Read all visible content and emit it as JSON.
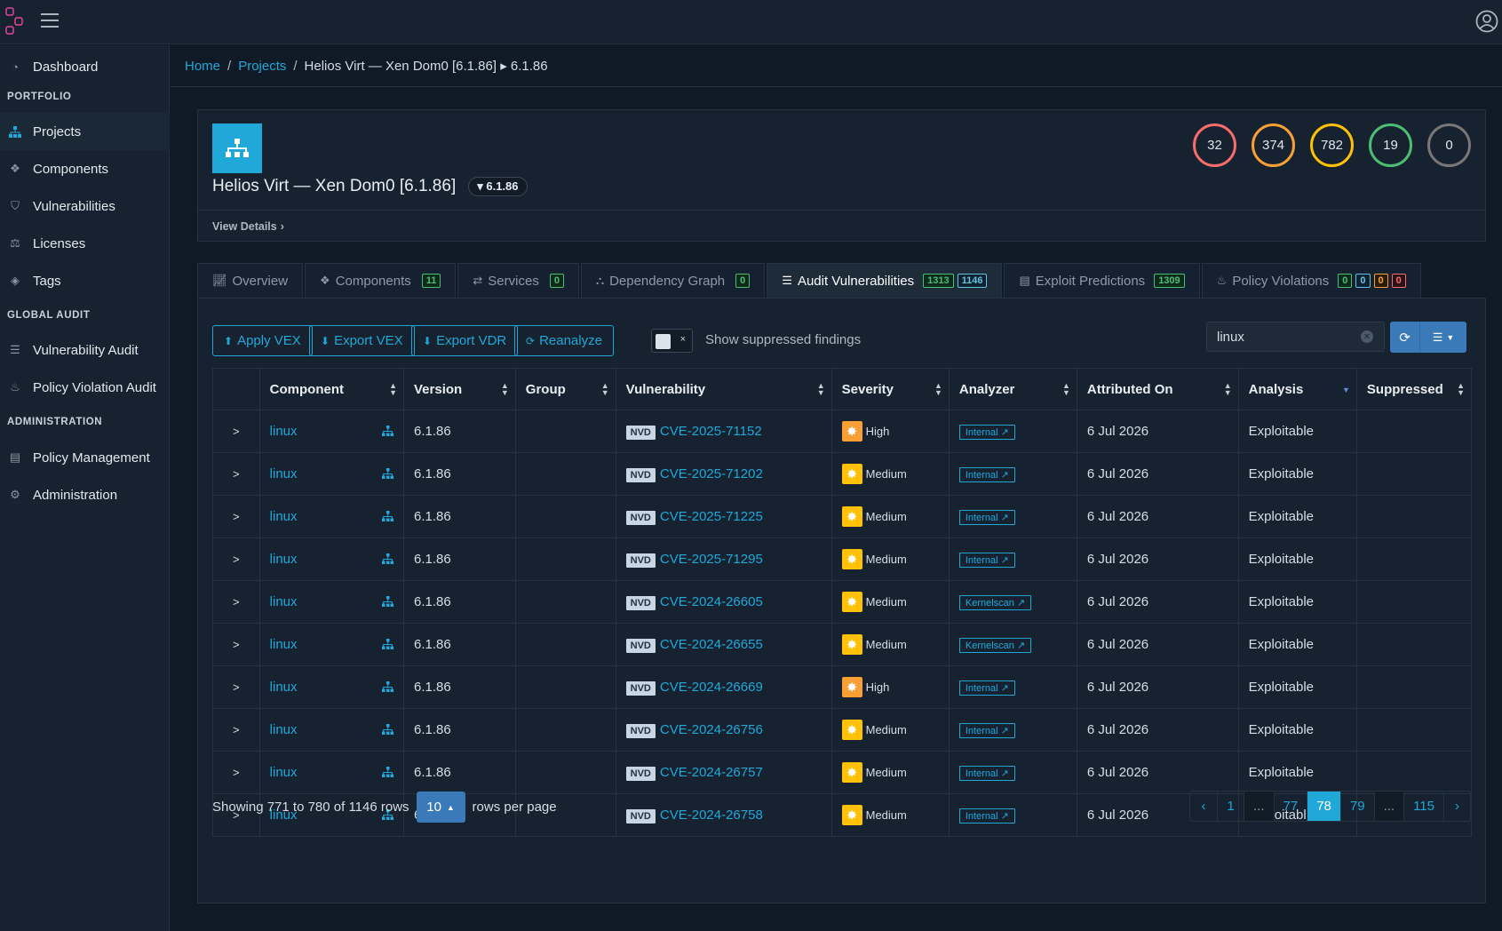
{
  "sidebar": {
    "items": [
      {
        "label": "Dashboard",
        "icon": "speedometer-icon"
      },
      {
        "label": "Projects",
        "icon": "sitemap-icon"
      },
      {
        "label": "Components",
        "icon": "cubes-icon"
      },
      {
        "label": "Vulnerabilities",
        "icon": "shield-icon"
      },
      {
        "label": "Licenses",
        "icon": "balance-scale-icon"
      },
      {
        "label": "Tags",
        "icon": "tag-icon"
      },
      {
        "label": "Vulnerability Audit",
        "icon": "list-icon"
      },
      {
        "label": "Policy Violation Audit",
        "icon": "fire-icon"
      },
      {
        "label": "Policy Management",
        "icon": "list-alt-icon"
      },
      {
        "label": "Administration",
        "icon": "cogs-icon"
      }
    ],
    "sections": [
      "PORTFOLIO",
      "GLOBAL AUDIT",
      "ADMINISTRATION"
    ]
  },
  "breadcrumb": {
    "home": "Home",
    "projects": "Projects",
    "current": "Helios Virt — Xen Dom0 [6.1.86] ▸ 6.1.86"
  },
  "project": {
    "name": "Helios Virt — Xen Dom0 [6.1.86]",
    "version": "6.1.86",
    "view_details": "View Details",
    "counts": {
      "critical": "32",
      "high": "374",
      "medium": "782",
      "low": "19",
      "unassigned": "0"
    },
    "colors": {
      "critical": "#f86c6b",
      "high": "#f8a036",
      "medium": "#ffc107",
      "low": "#4dbd74",
      "unassigned": "#777777"
    }
  },
  "tabs": [
    {
      "label": "Overview",
      "badges": []
    },
    {
      "label": "Components",
      "badges": [
        "11"
      ]
    },
    {
      "label": "Services",
      "badges": [
        "0"
      ]
    },
    {
      "label": "Dependency Graph",
      "badges": [
        "0"
      ]
    },
    {
      "label": "Audit Vulnerabilities",
      "badges": [
        "1313",
        "1146"
      ]
    },
    {
      "label": "Exploit Predictions",
      "badges": [
        "1309"
      ]
    },
    {
      "label": "Policy Violations",
      "badges": [
        "0",
        "0",
        "0",
        "0"
      ]
    }
  ],
  "toolbar": {
    "apply_vex": "Apply VEX",
    "export_vex": "Export VEX",
    "export_vdr": "Export VDR",
    "reanalyze": "Reanalyze",
    "show_suppressed": "Show suppressed findings",
    "switch_off_mark": "×",
    "search_value": "linux"
  },
  "table": {
    "headers": [
      "Component",
      "Version",
      "Group",
      "Vulnerability",
      "Severity",
      "Analyzer",
      "Attributed On",
      "Analysis",
      "Suppressed"
    ],
    "rows": [
      {
        "component": "linux",
        "version": "6.1.86",
        "group": "",
        "source": "NVD",
        "vuln": "CVE-2025-71152",
        "severity": "High",
        "analyzer": "Internal",
        "attributed": "6 Jul 2026",
        "analysis": "Exploitable",
        "suppressed": ""
      },
      {
        "component": "linux",
        "version": "6.1.86",
        "group": "",
        "source": "NVD",
        "vuln": "CVE-2025-71202",
        "severity": "Medium",
        "analyzer": "Internal",
        "attributed": "6 Jul 2026",
        "analysis": "Exploitable",
        "suppressed": ""
      },
      {
        "component": "linux",
        "version": "6.1.86",
        "group": "",
        "source": "NVD",
        "vuln": "CVE-2025-71225",
        "severity": "Medium",
        "analyzer": "Internal",
        "attributed": "6 Jul 2026",
        "analysis": "Exploitable",
        "suppressed": ""
      },
      {
        "component": "linux",
        "version": "6.1.86",
        "group": "",
        "source": "NVD",
        "vuln": "CVE-2025-71295",
        "severity": "Medium",
        "analyzer": "Internal",
        "attributed": "6 Jul 2026",
        "analysis": "Exploitable",
        "suppressed": ""
      },
      {
        "component": "linux",
        "version": "6.1.86",
        "group": "",
        "source": "NVD",
        "vuln": "CVE-2024-26605",
        "severity": "Medium",
        "analyzer": "Kernelscan",
        "attributed": "6 Jul 2026",
        "analysis": "Exploitable",
        "suppressed": ""
      },
      {
        "component": "linux",
        "version": "6.1.86",
        "group": "",
        "source": "NVD",
        "vuln": "CVE-2024-26655",
        "severity": "Medium",
        "analyzer": "Kernelscan",
        "attributed": "6 Jul 2026",
        "analysis": "Exploitable",
        "suppressed": ""
      },
      {
        "component": "linux",
        "version": "6.1.86",
        "group": "",
        "source": "NVD",
        "vuln": "CVE-2024-26669",
        "severity": "High",
        "analyzer": "Internal",
        "attributed": "6 Jul 2026",
        "analysis": "Exploitable",
        "suppressed": ""
      },
      {
        "component": "linux",
        "version": "6.1.86",
        "group": "",
        "source": "NVD",
        "vuln": "CVE-2024-26756",
        "severity": "Medium",
        "analyzer": "Internal",
        "attributed": "6 Jul 2026",
        "analysis": "Exploitable",
        "suppressed": ""
      },
      {
        "component": "linux",
        "version": "6.1.86",
        "group": "",
        "source": "NVD",
        "vuln": "CVE-2024-26757",
        "severity": "Medium",
        "analyzer": "Internal",
        "attributed": "6 Jul 2026",
        "analysis": "Exploitable",
        "suppressed": ""
      },
      {
        "component": "linux",
        "version": "6.1.86",
        "group": "",
        "source": "NVD",
        "vuln": "CVE-2024-26758",
        "severity": "Medium",
        "analyzer": "Internal",
        "attributed": "6 Jul 2026",
        "analysis": "Exploitable",
        "suppressed": ""
      }
    ]
  },
  "footer": {
    "showing": "Showing 771 to 780 of 1146 rows",
    "rows_per_page": "10",
    "rows_per_page_label": "rows per page",
    "pages": [
      "‹",
      "1",
      "...",
      "77",
      "78",
      "79",
      "...",
      "115",
      "›"
    ],
    "active_page": "78"
  },
  "colors": {
    "accent": "#20a8d8",
    "high": "#f8a036",
    "medium": "#ffc107"
  }
}
